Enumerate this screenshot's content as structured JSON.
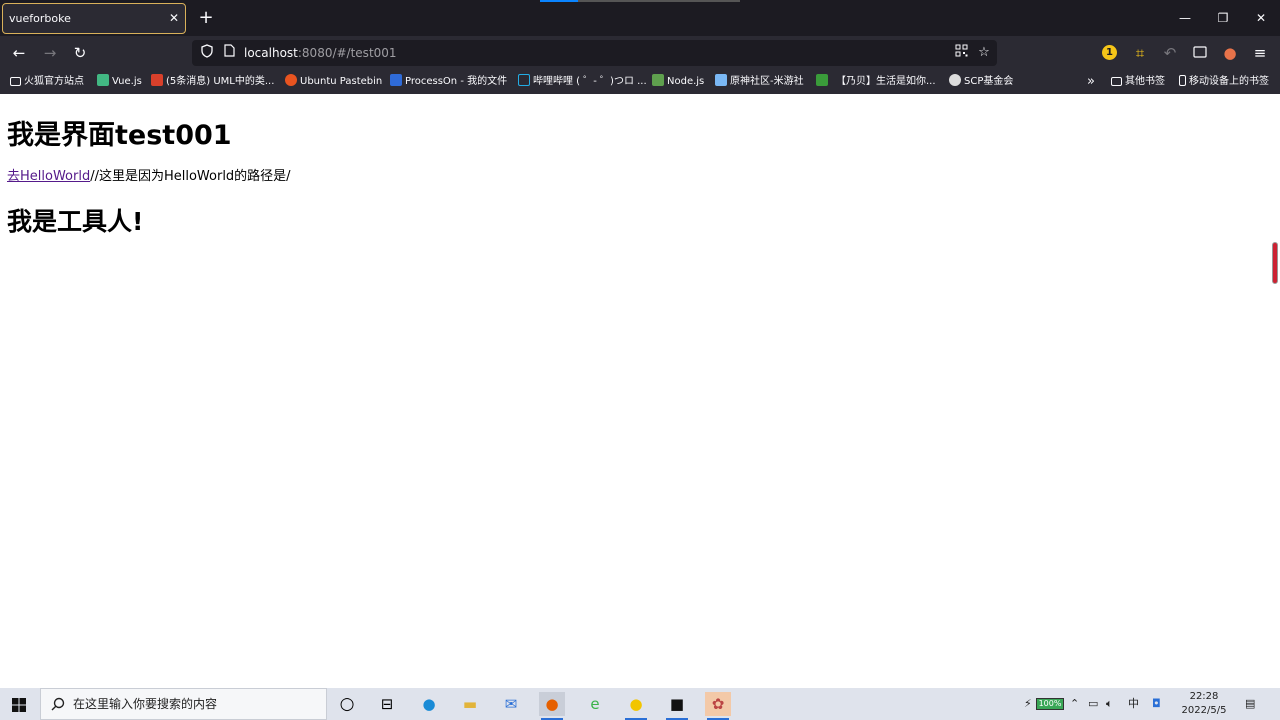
{
  "tab": {
    "title": "vueforboke",
    "close": "✕",
    "new": "+"
  },
  "window": {
    "minimize": "—",
    "restore": "❐",
    "close": "✕"
  },
  "nav": {
    "back": "←",
    "forward": "→",
    "reload": "↻"
  },
  "urlbar": {
    "host": "localhost",
    "rest": ":8080/#/test001"
  },
  "toolbar": {
    "badge_count": "1"
  },
  "bookmarks": [
    {
      "label": "火狐官方站点",
      "icon_color": "#c7a86b"
    },
    {
      "label": "Vue.js",
      "icon_color": "#42b883"
    },
    {
      "label": "(5条消息) UML中的类...",
      "icon_color": "#d9402b"
    },
    {
      "label": "Ubuntu Pastebin",
      "icon_color": "#e95420"
    },
    {
      "label": "ProcessOn - 我的文件",
      "icon_color": "#2f6bd8"
    },
    {
      "label": "哔哩哔哩 ( ゜- ゜)つロ ...",
      "icon_color": "#23ade5"
    },
    {
      "label": "Node.js",
      "icon_color": "#5fa04e"
    },
    {
      "label": "原神社区-米游社",
      "icon_color": "#7ab8f5"
    },
    {
      "label": "",
      "icon_color": "#3a9c3a"
    },
    {
      "label": "【乃贝】生活是如你...",
      "icon_color": "#2b2a33"
    },
    {
      "label": "SCP基金会",
      "icon_color": "#dddddd"
    }
  ],
  "bookmarks_right": [
    {
      "label": "其他书签"
    },
    {
      "label": "移动设备上的书签"
    }
  ],
  "page": {
    "heading": "我是界面test001",
    "link_text": "去HelloWorld",
    "link_suffix": "//这里是因为HelloWorld的路径是/",
    "subheading": "我是工具人!"
  },
  "taskbar": {
    "search_placeholder": "在这里输入你要搜索的内容",
    "battery": "100%",
    "ime": "中",
    "time": "22:28",
    "date": "2022/5/5"
  }
}
